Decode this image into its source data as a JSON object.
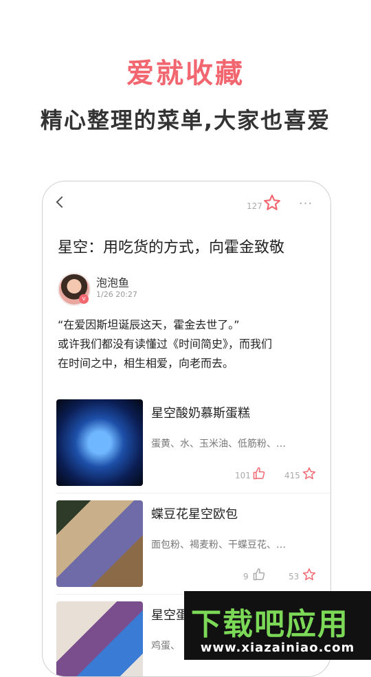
{
  "promo": {
    "headline": "爱就收藏",
    "subline": "精心整理的菜单,大家也喜爱"
  },
  "topbar": {
    "favorite_count": "127",
    "more_label": "···"
  },
  "article": {
    "title": "星空：用吃货的方式，向霍金致敬",
    "author": "泡泡鱼",
    "date": "1/26 20:27",
    "verified_badge": "v",
    "intro_lines": [
      "“在爱因斯坦诞辰这天，霍金去世了。”",
      "或许我们都没有读懂过《时间简史》，而我们",
      "在时间之中，相生相爱，向老而去。"
    ]
  },
  "recipes": [
    {
      "name": "星空酸奶慕斯蛋糕",
      "ingredients": "蛋黄、水、玉米油、低筋粉、…",
      "likes": "101",
      "favorites": "415"
    },
    {
      "name": "蝶豆花星空欧包",
      "ingredients": "面包粉、褐麦粉、干蝶豆花、…",
      "likes": "9",
      "favorites": "53"
    },
    {
      "name": "星空蛋",
      "ingredients": "鸡蛋、",
      "likes": "",
      "favorites": ""
    }
  ],
  "watermark": {
    "text": "下载吧应用",
    "url": "www.xiazainiao.com"
  },
  "colors": {
    "accent": "#f26670",
    "text_dark": "#222222",
    "muted": "#aaaaaa"
  },
  "icons": [
    "back-chevron-icon",
    "star-outline-icon",
    "more-dots-icon",
    "thumbs-up-icon",
    "star-icon"
  ]
}
